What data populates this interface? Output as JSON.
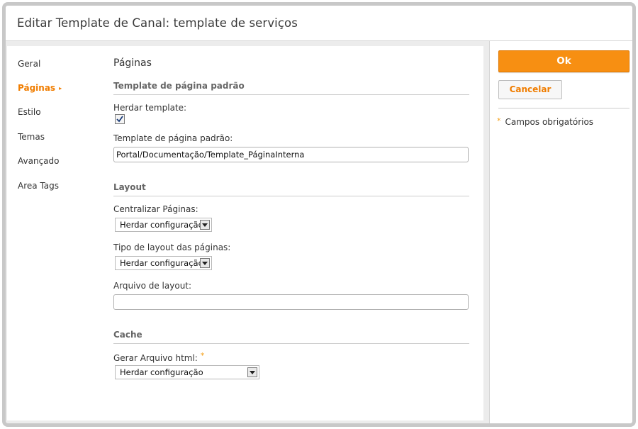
{
  "dialog": {
    "title": "Editar Template de Canal: template de serviços"
  },
  "sidebar": {
    "items": [
      {
        "label": "Geral"
      },
      {
        "label": "Páginas",
        "active": true
      },
      {
        "label": "Estilo"
      },
      {
        "label": "Temas"
      },
      {
        "label": "Avançado"
      },
      {
        "label": "Area Tags"
      }
    ],
    "active_arrow": "▸"
  },
  "main": {
    "section_title": "Páginas",
    "groups": {
      "template": {
        "title": "Template de página padrão",
        "inherit_label": "Herdar template:",
        "inherit_checked": true,
        "default_template_label": "Template de página padrão:",
        "default_template_value": "Portal/Documentação/Template_PáginaInterna"
      },
      "layout": {
        "title": "Layout",
        "center_label": "Centralizar Páginas:",
        "center_value": "Herdar configuração",
        "layout_type_label": "Tipo de layout das páginas:",
        "layout_type_value": "Herdar configuração",
        "layout_file_label": "Arquivo de layout:",
        "layout_file_value": ""
      },
      "cache": {
        "title": "Cache",
        "generate_html_label": "Gerar Arquivo html:",
        "generate_html_value": "Herdar configuração"
      }
    }
  },
  "actions": {
    "ok_label": "Ok",
    "cancel_label": "Cancelar",
    "required_star": "*",
    "required_note": "Campos obrigatórios"
  },
  "colors": {
    "accent": "#f78f12",
    "accent_text": "#f07d00",
    "required_star": "#f5a01a"
  }
}
